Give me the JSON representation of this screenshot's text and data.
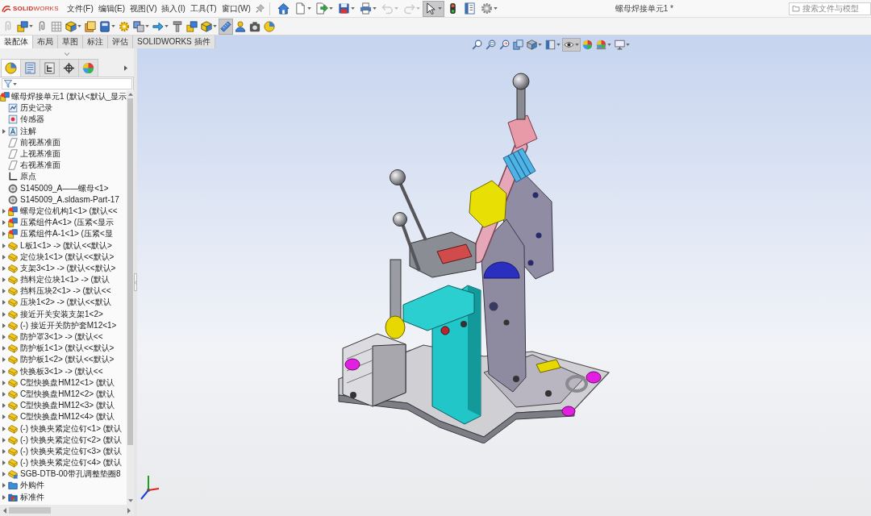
{
  "title_bar": {
    "logo": "**SOLID**WORKS",
    "menus": [
      {
        "label": "文件(F)"
      },
      {
        "label": "编辑(E)"
      },
      {
        "label": "视图(V)"
      },
      {
        "label": "插入(I)"
      },
      {
        "label": "工具(T)"
      },
      {
        "label": "窗口(W)"
      }
    ],
    "quick_access": [
      {
        "kind": "home",
        "dropdown": false,
        "pressed": false,
        "disabled": false
      },
      {
        "kind": "new",
        "dropdown": true,
        "pressed": false,
        "disabled": false
      },
      {
        "kind": "open",
        "dropdown": true,
        "pressed": false,
        "disabled": false
      },
      {
        "kind": "save",
        "dropdown": true,
        "pressed": false,
        "disabled": false
      },
      {
        "kind": "print",
        "dropdown": true,
        "pressed": false,
        "disabled": false
      },
      {
        "kind": "undo",
        "dropdown": true,
        "pressed": false,
        "disabled": true
      },
      {
        "kind": "redo",
        "dropdown": true,
        "pressed": false,
        "disabled": true
      },
      {
        "kind": "select",
        "dropdown": true,
        "pressed": true,
        "disabled": false
      },
      {
        "kind": "rebuild",
        "dropdown": false,
        "pressed": false,
        "disabled": false
      },
      {
        "kind": "properties",
        "dropdown": false,
        "pressed": false,
        "disabled": false
      },
      {
        "kind": "options",
        "dropdown": true,
        "pressed": false,
        "disabled": false
      }
    ],
    "title": "螺母焊接单元1 *",
    "search": {
      "placeholder": "搜索文件与模型"
    }
  },
  "toolbar": [
    {
      "kind": "paperclip",
      "dropdown": false,
      "pressed": false,
      "disabled": true
    },
    {
      "kind": "stack",
      "dropdown": true,
      "pressed": false,
      "disabled": false
    },
    {
      "kind": "paperclip",
      "dropdown": false,
      "pressed": false,
      "disabled": false
    },
    {
      "kind": "table",
      "dropdown": false,
      "pressed": false,
      "disabled": false
    },
    {
      "kind": "cube",
      "dropdown": true,
      "pressed": false,
      "disabled": false
    },
    {
      "kind": "sheets",
      "dropdown": false,
      "pressed": false,
      "disabled": false
    },
    {
      "kind": "book",
      "dropdown": true,
      "pressed": false,
      "disabled": false
    },
    {
      "kind": "gear",
      "dropdown": false,
      "pressed": false,
      "disabled": false
    },
    {
      "kind": "windows",
      "dropdown": true,
      "pressed": false,
      "disabled": false
    },
    {
      "kind": "arrows",
      "dropdown": true,
      "pressed": false,
      "disabled": false
    },
    {
      "kind": "bolt",
      "dropdown": false,
      "pressed": false,
      "disabled": false
    },
    {
      "kind": "stack",
      "dropdown": false,
      "pressed": false,
      "disabled": false
    },
    {
      "kind": "cube",
      "dropdown": true,
      "pressed": false,
      "disabled": false
    },
    {
      "kind": "ruler",
      "dropdown": false,
      "pressed": true,
      "disabled": false
    },
    {
      "kind": "person",
      "dropdown": false,
      "pressed": false,
      "disabled": false
    },
    {
      "kind": "camera",
      "dropdown": false,
      "pressed": false,
      "disabled": false
    },
    {
      "kind": "sphere",
      "dropdown": false,
      "pressed": false,
      "disabled": false
    }
  ],
  "command_tabs": [
    {
      "label": "装配体",
      "selected": true
    },
    {
      "label": "布局",
      "selected": false
    },
    {
      "label": "草图",
      "selected": false
    },
    {
      "label": "标注",
      "selected": false
    },
    {
      "label": "评估",
      "selected": false
    },
    {
      "label": "SOLIDWORKS 插件",
      "selected": false
    }
  ],
  "panel": {
    "tabs": [
      {
        "kind": "feature-tree",
        "selected": true
      },
      {
        "kind": "property",
        "selected": false
      },
      {
        "kind": "config",
        "selected": false
      },
      {
        "kind": "crosshair",
        "selected": false
      },
      {
        "kind": "pie",
        "selected": false
      }
    ],
    "tree": {
      "label": "螺母焊接单元1 (默认<默认_显示",
      "kind": "assembly",
      "children": [
        {
          "label": "历史记录",
          "kind": "history",
          "expandable": false
        },
        {
          "label": "传感器",
          "kind": "sensor",
          "expandable": false
        },
        {
          "label": "注解",
          "kind": "annotation",
          "expandable": true
        },
        {
          "label": "前视基准面",
          "kind": "plane",
          "expandable": false
        },
        {
          "label": "上视基准面",
          "kind": "plane",
          "expandable": false
        },
        {
          "label": "右视基准面",
          "kind": "plane",
          "expandable": false
        },
        {
          "label": "原点",
          "kind": "origin",
          "expandable": false
        },
        {
          "label": "S145009_A——螺母<1>",
          "kind": "ring",
          "expandable": false
        },
        {
          "label": "S145009_A.sldasm-Part-17",
          "kind": "ring",
          "expandable": false
        },
        {
          "label": "螺母定位机构1<1> (默认<<",
          "kind": "assembly",
          "expandable": true
        },
        {
          "label": "压紧组件A<1> (压紧<显示",
          "kind": "assembly",
          "expandable": true
        },
        {
          "label": "压紧组件A-1<1> (压紧<显",
          "kind": "assembly",
          "expandable": true
        },
        {
          "label": "L板1<1> -> (默认<<默认>",
          "kind": "part",
          "expandable": true
        },
        {
          "label": "定位块1<1> (默认<<默认>",
          "kind": "part",
          "expandable": true
        },
        {
          "label": "支架3<1> -> (默认<<默认>",
          "kind": "part",
          "expandable": true
        },
        {
          "label": "挡料定位块1<1> -> (默认",
          "kind": "part",
          "expandable": true
        },
        {
          "label": "挡料压块2<1> -> (默认<<",
          "kind": "part",
          "expandable": true
        },
        {
          "label": "压块1<2> -> (默认<<默认",
          "kind": "part",
          "expandable": true
        },
        {
          "label": "接近开关安装支架1<2>",
          "kind": "part",
          "expandable": true
        },
        {
          "label": "(-) 接近开关防护套M12<1>",
          "kind": "part",
          "expandable": true
        },
        {
          "label": "防护罩3<1> -> (默认<<",
          "kind": "part",
          "expandable": true
        },
        {
          "label": "防护板1<1> (默认<<默认>",
          "kind": "part",
          "expandable": true
        },
        {
          "label": "防护板1<2> (默认<<默认>",
          "kind": "part",
          "expandable": true
        },
        {
          "label": "快换板3<1> -> (默认<<",
          "kind": "part",
          "expandable": true
        },
        {
          "label": "C型快换盘HM12<1> (默认",
          "kind": "part",
          "expandable": true
        },
        {
          "label": "C型快换盘HM12<2> (默认",
          "kind": "part",
          "expandable": true
        },
        {
          "label": "C型快换盘HM12<3> (默认",
          "kind": "part",
          "expandable": true
        },
        {
          "label": "C型快换盘HM12<4> (默认",
          "kind": "part",
          "expandable": true
        },
        {
          "label": "(-) 快换夹紧定位钉<1> (默认",
          "kind": "part",
          "expandable": true
        },
        {
          "label": "(-) 快换夹紧定位钉<2> (默认",
          "kind": "part",
          "expandable": true
        },
        {
          "label": "(-) 快换夹紧定位钉<3> (默认",
          "kind": "part",
          "expandable": true
        },
        {
          "label": "(-) 快换夹紧定位钉<4> (默认",
          "kind": "part",
          "expandable": true
        },
        {
          "label": "SGB-DTB-00带孔调整垫圈8",
          "kind": "part-toolbox",
          "expandable": true
        },
        {
          "label": "外购件",
          "kind": "folder",
          "expandable": true
        },
        {
          "label": "标准件",
          "kind": "folder-standard",
          "expandable": true
        }
      ]
    }
  },
  "view_toolbar": [
    {
      "kind": "magnifier",
      "dropdown": false,
      "pressed": false
    },
    {
      "kind": "magnifier-box",
      "dropdown": false,
      "pressed": false
    },
    {
      "kind": "magnifier-arrow",
      "dropdown": false,
      "pressed": false
    },
    {
      "kind": "section-cube",
      "dropdown": false,
      "pressed": false
    },
    {
      "kind": "cube-views",
      "dropdown": true,
      "pressed": false
    },
    {
      "kind": "display-box",
      "dropdown": true,
      "pressed": false
    },
    {
      "kind": "eye",
      "dropdown": true,
      "pressed": true
    },
    {
      "kind": "color-ball",
      "dropdown": false,
      "pressed": false
    },
    {
      "kind": "color-scene",
      "dropdown": true,
      "pressed": false
    },
    {
      "kind": "monitor",
      "dropdown": true,
      "pressed": false
    }
  ]
}
